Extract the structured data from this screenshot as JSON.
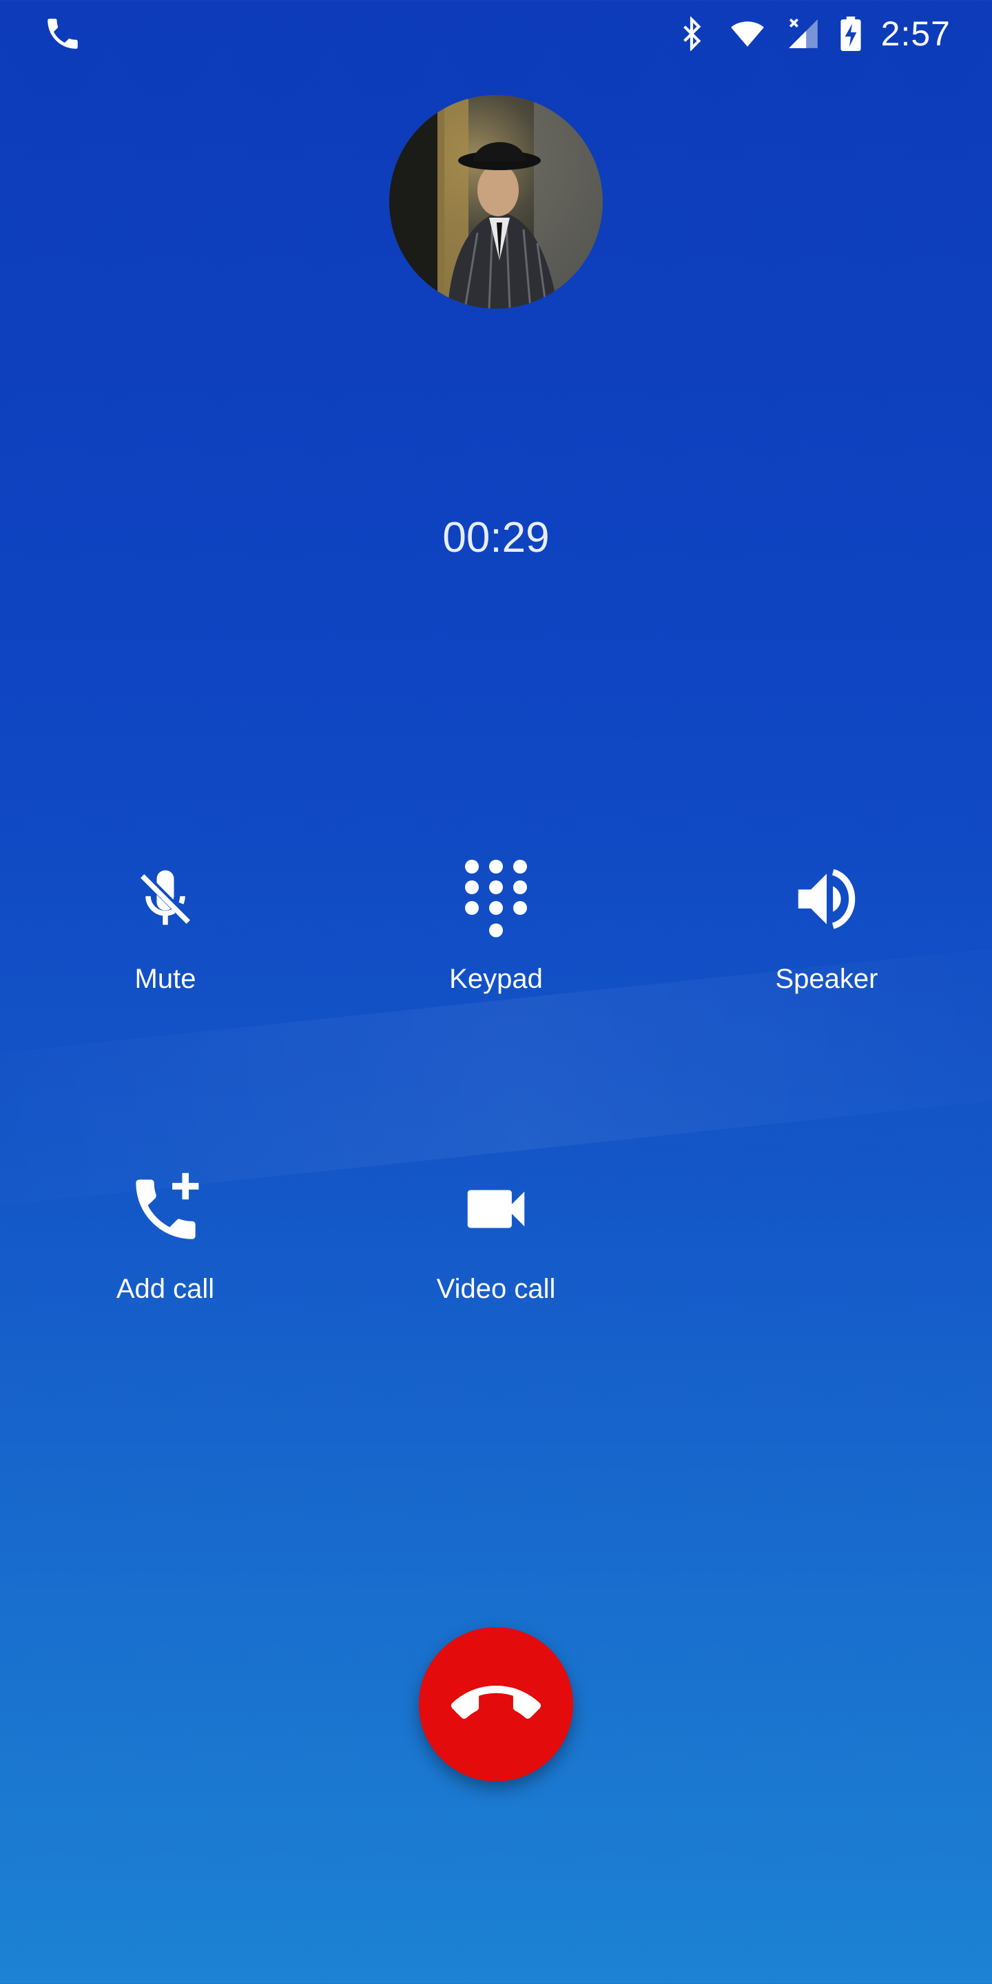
{
  "status_bar": {
    "time": "2:57",
    "icons": [
      "phone-icon",
      "bluetooth-icon",
      "wifi-icon",
      "cell-signal-icon",
      "battery-charging-icon"
    ]
  },
  "call": {
    "timer": "00:29",
    "avatar_icon": "contact-avatar"
  },
  "actions": {
    "mute": {
      "label": "Mute",
      "icon": "mic-off-icon"
    },
    "keypad": {
      "label": "Keypad",
      "icon": "dialpad-icon"
    },
    "speaker": {
      "label": "Speaker",
      "icon": "speaker-icon"
    },
    "add_call": {
      "label": "Add call",
      "icon": "add-call-icon"
    },
    "video_call": {
      "label": "Video call",
      "icon": "video-camera-icon"
    }
  },
  "end_call": {
    "icon": "end-call-icon",
    "color": "#e30b0b"
  },
  "colors": {
    "background_top": "#0d3bb9",
    "background_bottom": "#1d82d3",
    "text": "#ffffff"
  }
}
